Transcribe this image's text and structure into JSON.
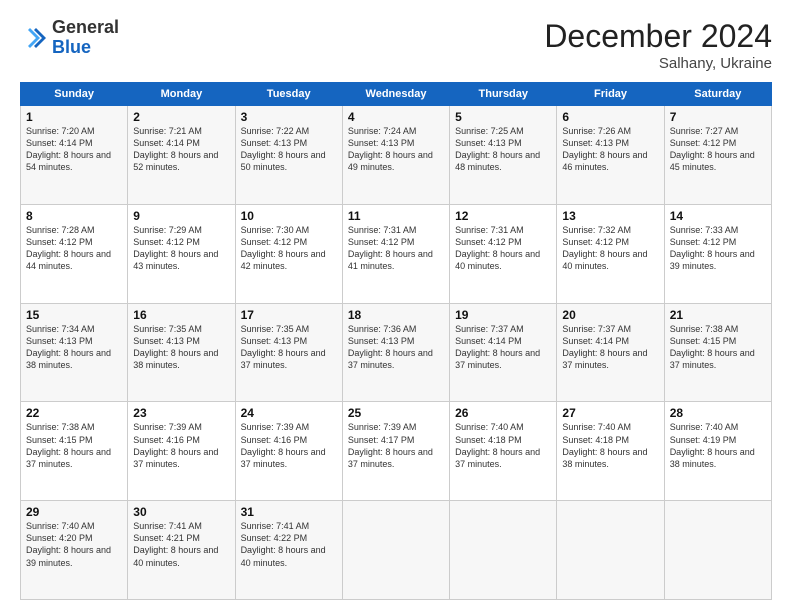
{
  "logo": {
    "general": "General",
    "blue": "Blue"
  },
  "header": {
    "month": "December 2024",
    "location": "Salhany, Ukraine"
  },
  "weekdays": [
    "Sunday",
    "Monday",
    "Tuesday",
    "Wednesday",
    "Thursday",
    "Friday",
    "Saturday"
  ],
  "weeks": [
    [
      {
        "day": 1,
        "sunrise": "7:20 AM",
        "sunset": "4:14 PM",
        "daylight": "8 hours and 54 minutes."
      },
      {
        "day": 2,
        "sunrise": "7:21 AM",
        "sunset": "4:14 PM",
        "daylight": "8 hours and 52 minutes."
      },
      {
        "day": 3,
        "sunrise": "7:22 AM",
        "sunset": "4:13 PM",
        "daylight": "8 hours and 50 minutes."
      },
      {
        "day": 4,
        "sunrise": "7:24 AM",
        "sunset": "4:13 PM",
        "daylight": "8 hours and 49 minutes."
      },
      {
        "day": 5,
        "sunrise": "7:25 AM",
        "sunset": "4:13 PM",
        "daylight": "8 hours and 48 minutes."
      },
      {
        "day": 6,
        "sunrise": "7:26 AM",
        "sunset": "4:13 PM",
        "daylight": "8 hours and 46 minutes."
      },
      {
        "day": 7,
        "sunrise": "7:27 AM",
        "sunset": "4:12 PM",
        "daylight": "8 hours and 45 minutes."
      }
    ],
    [
      {
        "day": 8,
        "sunrise": "7:28 AM",
        "sunset": "4:12 PM",
        "daylight": "8 hours and 44 minutes."
      },
      {
        "day": 9,
        "sunrise": "7:29 AM",
        "sunset": "4:12 PM",
        "daylight": "8 hours and 43 minutes."
      },
      {
        "day": 10,
        "sunrise": "7:30 AM",
        "sunset": "4:12 PM",
        "daylight": "8 hours and 42 minutes."
      },
      {
        "day": 11,
        "sunrise": "7:31 AM",
        "sunset": "4:12 PM",
        "daylight": "8 hours and 41 minutes."
      },
      {
        "day": 12,
        "sunrise": "7:31 AM",
        "sunset": "4:12 PM",
        "daylight": "8 hours and 40 minutes."
      },
      {
        "day": 13,
        "sunrise": "7:32 AM",
        "sunset": "4:12 PM",
        "daylight": "8 hours and 40 minutes."
      },
      {
        "day": 14,
        "sunrise": "7:33 AM",
        "sunset": "4:12 PM",
        "daylight": "8 hours and 39 minutes."
      }
    ],
    [
      {
        "day": 15,
        "sunrise": "7:34 AM",
        "sunset": "4:13 PM",
        "daylight": "8 hours and 38 minutes."
      },
      {
        "day": 16,
        "sunrise": "7:35 AM",
        "sunset": "4:13 PM",
        "daylight": "8 hours and 38 minutes."
      },
      {
        "day": 17,
        "sunrise": "7:35 AM",
        "sunset": "4:13 PM",
        "daylight": "8 hours and 37 minutes."
      },
      {
        "day": 18,
        "sunrise": "7:36 AM",
        "sunset": "4:13 PM",
        "daylight": "8 hours and 37 minutes."
      },
      {
        "day": 19,
        "sunrise": "7:37 AM",
        "sunset": "4:14 PM",
        "daylight": "8 hours and 37 minutes."
      },
      {
        "day": 20,
        "sunrise": "7:37 AM",
        "sunset": "4:14 PM",
        "daylight": "8 hours and 37 minutes."
      },
      {
        "day": 21,
        "sunrise": "7:38 AM",
        "sunset": "4:15 PM",
        "daylight": "8 hours and 37 minutes."
      }
    ],
    [
      {
        "day": 22,
        "sunrise": "7:38 AM",
        "sunset": "4:15 PM",
        "daylight": "8 hours and 37 minutes."
      },
      {
        "day": 23,
        "sunrise": "7:39 AM",
        "sunset": "4:16 PM",
        "daylight": "8 hours and 37 minutes."
      },
      {
        "day": 24,
        "sunrise": "7:39 AM",
        "sunset": "4:16 PM",
        "daylight": "8 hours and 37 minutes."
      },
      {
        "day": 25,
        "sunrise": "7:39 AM",
        "sunset": "4:17 PM",
        "daylight": "8 hours and 37 minutes."
      },
      {
        "day": 26,
        "sunrise": "7:40 AM",
        "sunset": "4:18 PM",
        "daylight": "8 hours and 37 minutes."
      },
      {
        "day": 27,
        "sunrise": "7:40 AM",
        "sunset": "4:18 PM",
        "daylight": "8 hours and 38 minutes."
      },
      {
        "day": 28,
        "sunrise": "7:40 AM",
        "sunset": "4:19 PM",
        "daylight": "8 hours and 38 minutes."
      }
    ],
    [
      {
        "day": 29,
        "sunrise": "7:40 AM",
        "sunset": "4:20 PM",
        "daylight": "8 hours and 39 minutes."
      },
      {
        "day": 30,
        "sunrise": "7:41 AM",
        "sunset": "4:21 PM",
        "daylight": "8 hours and 40 minutes."
      },
      {
        "day": 31,
        "sunrise": "7:41 AM",
        "sunset": "4:22 PM",
        "daylight": "8 hours and 40 minutes."
      },
      null,
      null,
      null,
      null
    ]
  ]
}
